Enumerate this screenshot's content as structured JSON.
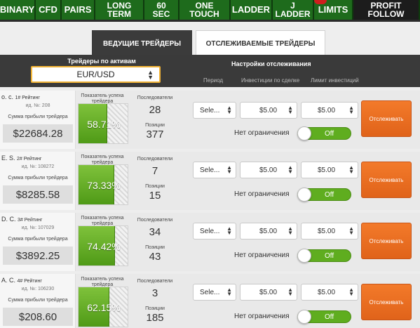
{
  "nav": {
    "tabs": [
      {
        "label": "BINARY"
      },
      {
        "label": "CFD"
      },
      {
        "label": "PAIRS"
      },
      {
        "label": "LONG\nTERM"
      },
      {
        "label": "60\nSEC"
      },
      {
        "label": "ONE\nTOUCH"
      },
      {
        "label": "LADDER"
      },
      {
        "label": "J\nLADDER"
      },
      {
        "label": "LIMITS"
      },
      {
        "label": "PROFIT\nFOLLOW"
      }
    ]
  },
  "tabs": {
    "leading": "ВЕДУЩИЕ ТРЕЙДЕРЫ",
    "tracked": "ОТСЛЕЖИВАЕМЫЕ ТРЕЙДЕРЫ"
  },
  "header": {
    "assets_label": "Трейдеры по активам",
    "asset_value": "EUR/USD",
    "tracking_settings": "Настройки отслеживания",
    "col_period": "Период",
    "col_investment": "Инвестиции по сделке",
    "col_limit": "Лимит инвестиций"
  },
  "labels": {
    "profit": "Сумма прибыли трейдера",
    "success": "Показатель успеха трейдера",
    "followers": "Последователи",
    "positions": "Позиции",
    "no_limit": "Нет ограничения",
    "toggle_off": "Off",
    "track_button": "Отслеживать",
    "select_placeholder": "Sele..."
  },
  "traders": [
    {
      "name": "о. с.",
      "rank": "1# Рейтинг",
      "id": "ид. №: 208",
      "profit": "$22684.28",
      "success_pct": 58.71,
      "success_text": "58.71%",
      "followers": "28",
      "positions": "377",
      "investment": "$5.00",
      "limit": "$5.00"
    },
    {
      "name": "E. S.",
      "rank": "2# Рейтинг",
      "id": "ид. №: 108272",
      "profit": "$8285.58",
      "success_pct": 73.33,
      "success_text": "73.33%",
      "followers": "7",
      "positions": "15",
      "investment": "$5.00",
      "limit": "$5.00"
    },
    {
      "name": "D. C.",
      "rank": "3# Рейтинг",
      "id": "ид. №: 107029",
      "profit": "$3892.25",
      "success_pct": 74.42,
      "success_text": "74.42%",
      "followers": "34",
      "positions": "43",
      "investment": "$5.00",
      "limit": "$5.00"
    },
    {
      "name": "A. C.",
      "rank": "4# Рейтинг",
      "id": "ид. №: 106230",
      "profit": "$208.60",
      "success_pct": 62.15,
      "success_text": "62.15%",
      "followers": "3",
      "positions": "185",
      "investment": "$5.00",
      "limit": "$5.00"
    }
  ]
}
